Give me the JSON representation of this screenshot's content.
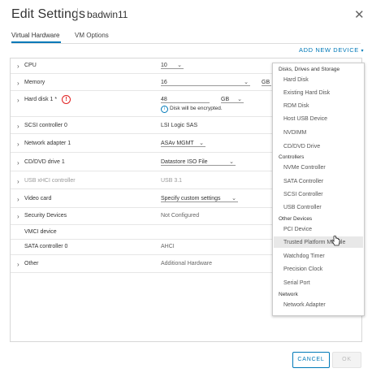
{
  "header": {
    "title": "Edit Settings",
    "vm_name": "badwin11",
    "close_icon": "close-icon"
  },
  "tabs": [
    {
      "label": "Virtual Hardware",
      "active": true
    },
    {
      "label": "VM Options",
      "active": false
    }
  ],
  "add_device_label": "ADD NEW DEVICE",
  "hardware": {
    "cpu": {
      "label": "CPU",
      "value": "10"
    },
    "memory": {
      "label": "Memory",
      "value": "16",
      "unit_partial": "GB"
    },
    "hard_disk": {
      "label": "Hard disk 1 *",
      "value": "48",
      "unit": "GB",
      "note": "Disk will be encrypted."
    },
    "scsi": {
      "label": "SCSI controller 0",
      "value": "LSI Logic SAS"
    },
    "network": {
      "label": "Network adapter 1",
      "value": "ASAv MGMT"
    },
    "cdrom": {
      "label": "CD/DVD drive 1",
      "value": "Datastore ISO File"
    },
    "usb": {
      "label": "USB xHCI controller",
      "value": "USB 3.1"
    },
    "video": {
      "label": "Video card",
      "value": "Specify custom settings"
    },
    "security": {
      "label": "Security Devices",
      "value": "Not Configured"
    },
    "vmci": {
      "label": "VMCI device",
      "value": ""
    },
    "sata": {
      "label": "SATA controller 0",
      "value": "AHCI"
    },
    "other": {
      "label": "Other",
      "value": "Additional Hardware"
    }
  },
  "device_menu": {
    "sections": [
      {
        "heading": "Disks, Drives and Storage",
        "items": [
          "Hard Disk",
          "Existing Hard Disk",
          "RDM Disk",
          "Host USB Device",
          "NVDIMM",
          "CD/DVD Drive"
        ]
      },
      {
        "heading": "Controllers",
        "items": [
          "NVMe Controller",
          "SATA Controller",
          "SCSI Controller",
          "USB Controller"
        ]
      },
      {
        "heading": "Other Devices",
        "items": [
          "PCI Device",
          "Trusted Platform Module",
          "Watchdog Timer",
          "Precision Clock",
          "Serial Port"
        ]
      },
      {
        "heading": "Network",
        "items": [
          "Network Adapter"
        ]
      }
    ],
    "hovered_item": "Trusted Platform Module"
  },
  "footer": {
    "cancel_label": "CANCEL",
    "ok_label": "OK"
  },
  "colors": {
    "accent": "#0079b8",
    "warning": "#e02020",
    "menu_hover": "#e8e8e8"
  }
}
